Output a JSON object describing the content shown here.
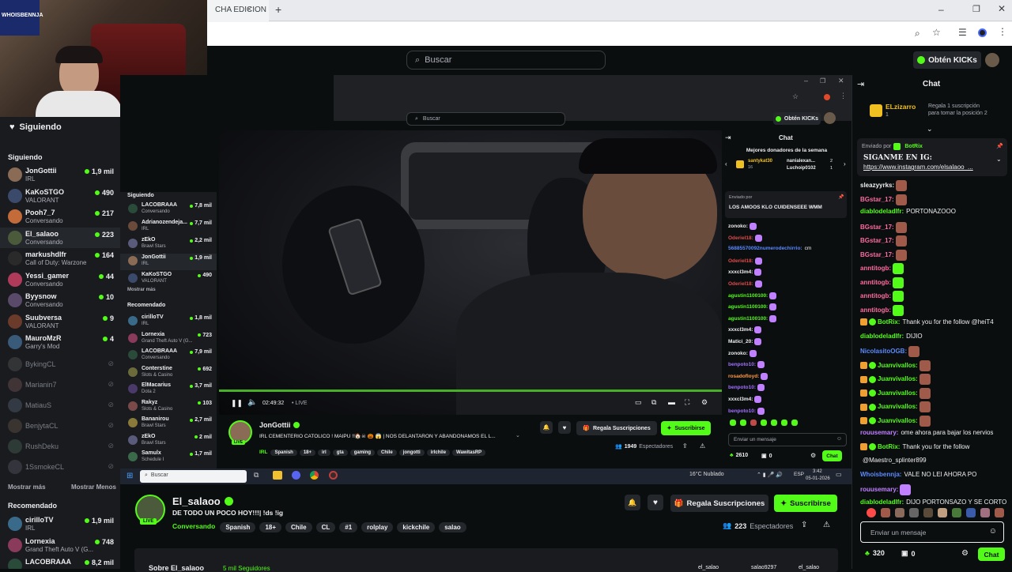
{
  "browser": {
    "tab_title": "CHA EDICION",
    "tab_close": "×",
    "new_tab": "+"
  },
  "topbar": {
    "search_placeholder": "Buscar",
    "get_kicks": "Obtén KICKs"
  },
  "webcam_overlay_text": "WHOISBENNJA",
  "sidebar": {
    "header": "Siguiendo",
    "section_following": "Siguiendo",
    "following": [
      {
        "name": "JonGottii",
        "category": "IRL",
        "count": "1,9 mil",
        "color": "#8a6b55"
      },
      {
        "name": "KaKoSTGO",
        "category": "VALORANT",
        "count": "490",
        "color": "#3b4a6b"
      },
      {
        "name": "Pooh7_7",
        "category": "Conversando",
        "count": "217",
        "color": "#c46b3a"
      },
      {
        "name": "El_salaoo",
        "category": "Conversando",
        "count": "223",
        "color": "#4a5a3a"
      },
      {
        "name": "markushdlfr",
        "category": "Call of Duty: Warzone",
        "count": "164",
        "color": "#2a2a2a"
      },
      {
        "name": "Yessi_gamer",
        "category": "Conversando",
        "count": "44",
        "color": "#b03a5a"
      },
      {
        "name": "Byysnow",
        "category": "Conversando",
        "count": "10",
        "color": "#5a4a6a"
      },
      {
        "name": "Suubversa",
        "category": "VALORANT",
        "count": "9",
        "color": "#6a3a2a"
      },
      {
        "name": "MauroMzR",
        "category": "Garry's Mod",
        "count": "4",
        "color": "#3a5a7a"
      }
    ],
    "offline": [
      {
        "name": "BykingCL",
        "color": "#5a5a5a"
      },
      {
        "name": "Marianin7",
        "color": "#7a5a5a"
      },
      {
        "name": "MatiauS",
        "color": "#5a6a7a"
      },
      {
        "name": "BenjytaCL",
        "color": "#6a5a4a"
      },
      {
        "name": "RushDeku",
        "color": "#4a6a5a"
      },
      {
        "name": "1SsmokeCL",
        "color": "#5a5a6a"
      }
    ],
    "show_more": "Mostrar más",
    "show_less": "Mostrar Menos",
    "section_recommended": "Recomendado",
    "recommended": [
      {
        "name": "cirilloTV",
        "category": "IRL",
        "count": "1,9 mil",
        "color": "#3a6a8a"
      },
      {
        "name": "Lornexia",
        "category": "Grand Theft Auto V (G...",
        "count": "748",
        "color": "#8a3a5a"
      },
      {
        "name": "LACOBRAAA",
        "category": "",
        "count": "8,2 mil",
        "color": "#2a4a3a"
      }
    ]
  },
  "inner_app": {
    "search_placeholder": "Buscar",
    "get_kicks": "Obtén KICKs",
    "sidebar_header": "Siguiendo",
    "following": [
      {
        "name": "LACOBRAAA",
        "category": "Conversando",
        "count": "7,8 mil",
        "color": "#2a4a3a"
      },
      {
        "name": "Adrianozendeja...",
        "category": "IRL",
        "count": "7,7 mil",
        "color": "#6a4a3a"
      },
      {
        "name": "zEkO",
        "category": "Brawl Stars",
        "count": "2,2 mil",
        "color": "#5a5a7a"
      },
      {
        "name": "JonGottii",
        "category": "IRL",
        "count": "1,9 mil",
        "color": "#8a6b55"
      },
      {
        "name": "KaKoSTGO",
        "category": "VALORANT",
        "count": "490",
        "color": "#3b4a6b"
      }
    ],
    "show_more": "Mostrar más",
    "recommended_header": "Recomendado",
    "recommended": [
      {
        "name": "cirilloTV",
        "category": "IRL",
        "count": "1,8 mil",
        "color": "#3a6a8a"
      },
      {
        "name": "Lornexia",
        "category": "Grand Theft Auto V (G...",
        "count": "723",
        "color": "#8a3a5a"
      },
      {
        "name": "LACOBRAAA",
        "category": "Conversando",
        "count": "7,9 mil",
        "color": "#2a4a3a"
      },
      {
        "name": "Conterstine",
        "category": "Slots & Casino",
        "count": "692",
        "color": "#6a6a3a"
      },
      {
        "name": "ElMacarius",
        "category": "Dota 2",
        "count": "3,7 mil",
        "color": "#4a3a6a"
      },
      {
        "name": "Rakyz",
        "category": "Slots & Casino",
        "count": "103",
        "color": "#7a4a4a"
      },
      {
        "name": "Bananirou",
        "category": "Brawl Stars",
        "count": "2,7 mil",
        "color": "#8a7a3a"
      },
      {
        "name": "zEkO",
        "category": "Brawl Stars",
        "count": "2 mil",
        "color": "#5a5a7a"
      },
      {
        "name": "Samulx",
        "category": "Schedule I",
        "count": "1,7 mil",
        "color": "#3a6a4a"
      }
    ],
    "player": {
      "time": "02:49:32",
      "live": "• LIVE"
    },
    "stream": {
      "streamer": "JonGottii",
      "title": "IRL CEMENTERIO CATOLICO ! MAIPU !!🏠☠ 🎃 😱 | NOS DELANTARON Y ABANDONAMOS EL L...",
      "tags": [
        "IRL",
        "Spanish",
        "18+",
        "irl",
        "gta",
        "gaming",
        "Chile",
        "jongotti",
        "irlchile",
        "WawitasRP"
      ],
      "gift_subs": "Regala Suscripciones",
      "subscribe": "Suscribirse",
      "viewers": "1949",
      "viewers_label": "Espectadores",
      "live_badge": "LIVE"
    },
    "chat": {
      "title": "Chat",
      "top_donors": "Mejores donadores de la semana",
      "donors": [
        {
          "name": "santykat30",
          "amount": "16"
        },
        {
          "name": "nanialexan...",
          "amount": "2"
        },
        {
          "name": "Luchoip0102",
          "amount": "1"
        }
      ],
      "pinned_by": "Enviado por",
      "pinned_msg": "LOS AMOOS KLO CUIDENSEEE WMM",
      "messages": [
        {
          "user": "zonoko:",
          "text": "",
          "color": "#efeff1"
        },
        {
          "user": "Oderiel18:",
          "text": "",
          "color": "#e04a4a"
        },
        {
          "user": "56885570092numerodechirrio:",
          "text": "cm",
          "color": "#5a8aff"
        },
        {
          "user": "Oderiel18:",
          "text": "",
          "color": "#e04a4a"
        },
        {
          "user": "xxxcl3m4:",
          "text": "",
          "color": "#efeff1"
        },
        {
          "user": "Oderiel18:",
          "text": "",
          "color": "#e04a4a"
        },
        {
          "user": "agustin1100100:",
          "text": "",
          "color": "#53fc18"
        },
        {
          "user": "agustin1100100:",
          "text": "",
          "color": "#53fc18"
        },
        {
          "user": "agustin1100100:",
          "text": "",
          "color": "#53fc18"
        },
        {
          "user": "xxxcl3m4:",
          "text": "",
          "color": "#efeff1"
        },
        {
          "user": "Matici_20:",
          "text": "",
          "color": "#efeff1"
        },
        {
          "user": "zonoko:",
          "text": "",
          "color": "#efeff1"
        },
        {
          "user": "benpoto10:",
          "text": "",
          "color": "#a070ff"
        },
        {
          "user": "rosadofloyd:",
          "text": "",
          "color": "#ff9a4a"
        },
        {
          "user": "benpoto10:",
          "text": "",
          "color": "#a070ff"
        },
        {
          "user": "xxxcl3m4:",
          "text": "",
          "color": "#efeff1"
        },
        {
          "user": "benpoto10:",
          "text": "",
          "color": "#a070ff"
        }
      ],
      "input_placeholder": "Enviar un mensaje",
      "points": "2610",
      "gifts": "0",
      "send": "Chat"
    }
  },
  "taskbar": {
    "search": "Buscar",
    "weather": "16°C  Nublado",
    "lang": "ESP",
    "time": "3:42",
    "date": "05-01-2026"
  },
  "channel": {
    "name": "El_salaoo",
    "title": "DE TODO UN POCO HOY!!!| !ds !ig",
    "category": "Conversando",
    "tags": [
      "Spanish",
      "18+",
      "Chile",
      "CL",
      "#1",
      "rolplay",
      "kickchile",
      "salao"
    ],
    "gift_subs": "Regala Suscripciones",
    "subscribe": "Suscribirse",
    "viewers": "223",
    "viewers_label": "Espectadores",
    "live_badge": "LIVE",
    "about_partial": "Sobre El_salaoo",
    "followers_partial": "5 mil Seguidores",
    "socials": [
      "el_salao",
      "salao9297",
      "el_salao"
    ]
  },
  "main_chat": {
    "title": "Chat",
    "leader_name": "ELzizarro",
    "leader_count": "1",
    "leader_hint_1": "Regala 1 suscripción",
    "leader_hint_2": "para tomar la posición 2",
    "pinned_by": "Enviado por",
    "pinned_user": "BotRix",
    "pinned_line1": "SIGANME EN IG:",
    "pinned_line2": "https://www.instagram.com/elsalaoo_...",
    "messages": [
      {
        "user": "sleazyyrks:",
        "text": "",
        "color": "#efeff1",
        "emote": "#a05a4a"
      },
      {
        "user": "BGstar_17:",
        "text": "",
        "color": "#ff6aa0",
        "emote": "#a05a4a"
      },
      {
        "user": "diablodeladlfr:",
        "text": "PORTONAZOOO",
        "color": "#53fc18",
        "emote": ""
      },
      {
        "user": "BGstar_17:",
        "text": "",
        "color": "#ff6aa0",
        "emote": "#a05a4a"
      },
      {
        "user": "BGstar_17:",
        "text": "",
        "color": "#ff6aa0",
        "emote": "#a05a4a"
      },
      {
        "user": "BGstar_17:",
        "text": "",
        "color": "#ff6aa0",
        "emote": "#a05a4a"
      },
      {
        "user": "anntitogb:",
        "text": "",
        "color": "#ff6aa0",
        "emote": "#53fc18"
      },
      {
        "user": "anntitogb:",
        "text": "",
        "color": "#ff6aa0",
        "emote": "#53fc18"
      },
      {
        "user": "anntitogb:",
        "text": "",
        "color": "#ff6aa0",
        "emote": "#53fc18"
      },
      {
        "user": "anntitogb:",
        "text": "",
        "color": "#ff6aa0",
        "emote": "#53fc18"
      },
      {
        "user": "BotRix:",
        "text": "Thank you for the follow @heiT4",
        "color": "#53fc18",
        "emote": ""
      },
      {
        "user": "diablodeladlfr:",
        "text": "DIJIO",
        "color": "#53fc18",
        "emote": ""
      },
      {
        "user": "NicolasitoOGB:",
        "text": "",
        "color": "#5a8aff",
        "emote": "#a05a4a"
      },
      {
        "user": "Juanvivallos:",
        "text": "",
        "color": "#53fc18",
        "emote": "#a05a4a"
      },
      {
        "user": "Juanvivallos:",
        "text": "",
        "color": "#53fc18",
        "emote": "#a05a4a"
      },
      {
        "user": "Juanvivallos:",
        "text": "",
        "color": "#53fc18",
        "emote": "#a05a4a"
      },
      {
        "user": "Juanvivallos:",
        "text": "",
        "color": "#53fc18",
        "emote": "#a05a4a"
      },
      {
        "user": "Juanvivallos:",
        "text": "",
        "color": "#53fc18",
        "emote": "#a05a4a"
      },
      {
        "user": "rouusemary:",
        "text": "ome ahora para bajar los nervios",
        "color": "#c080ff",
        "emote": ""
      },
      {
        "user": "BotRix:",
        "text": "Thank you for the follow",
        "color": "#53fc18",
        "emote": ""
      },
      {
        "user": "",
        "text": "@Maestro_splinter899",
        "color": "#efeff1",
        "emote": ""
      },
      {
        "user": "Whoisbennja:",
        "text": "VALE NO LEI AHORA PO",
        "color": "#5a8aff",
        "emote": ""
      },
      {
        "user": "rouusemary:",
        "text": "",
        "color": "#c080ff",
        "emote": "#c080ff"
      },
      {
        "user": "diablodeladlfr:",
        "text": "DIJO PORTONSAZO Y SE CORTO",
        "color": "#53fc18",
        "emote": ""
      }
    ],
    "input_placeholder": "Enviar un mensaje",
    "points": "320",
    "gifts": "0",
    "send": "Chat"
  }
}
